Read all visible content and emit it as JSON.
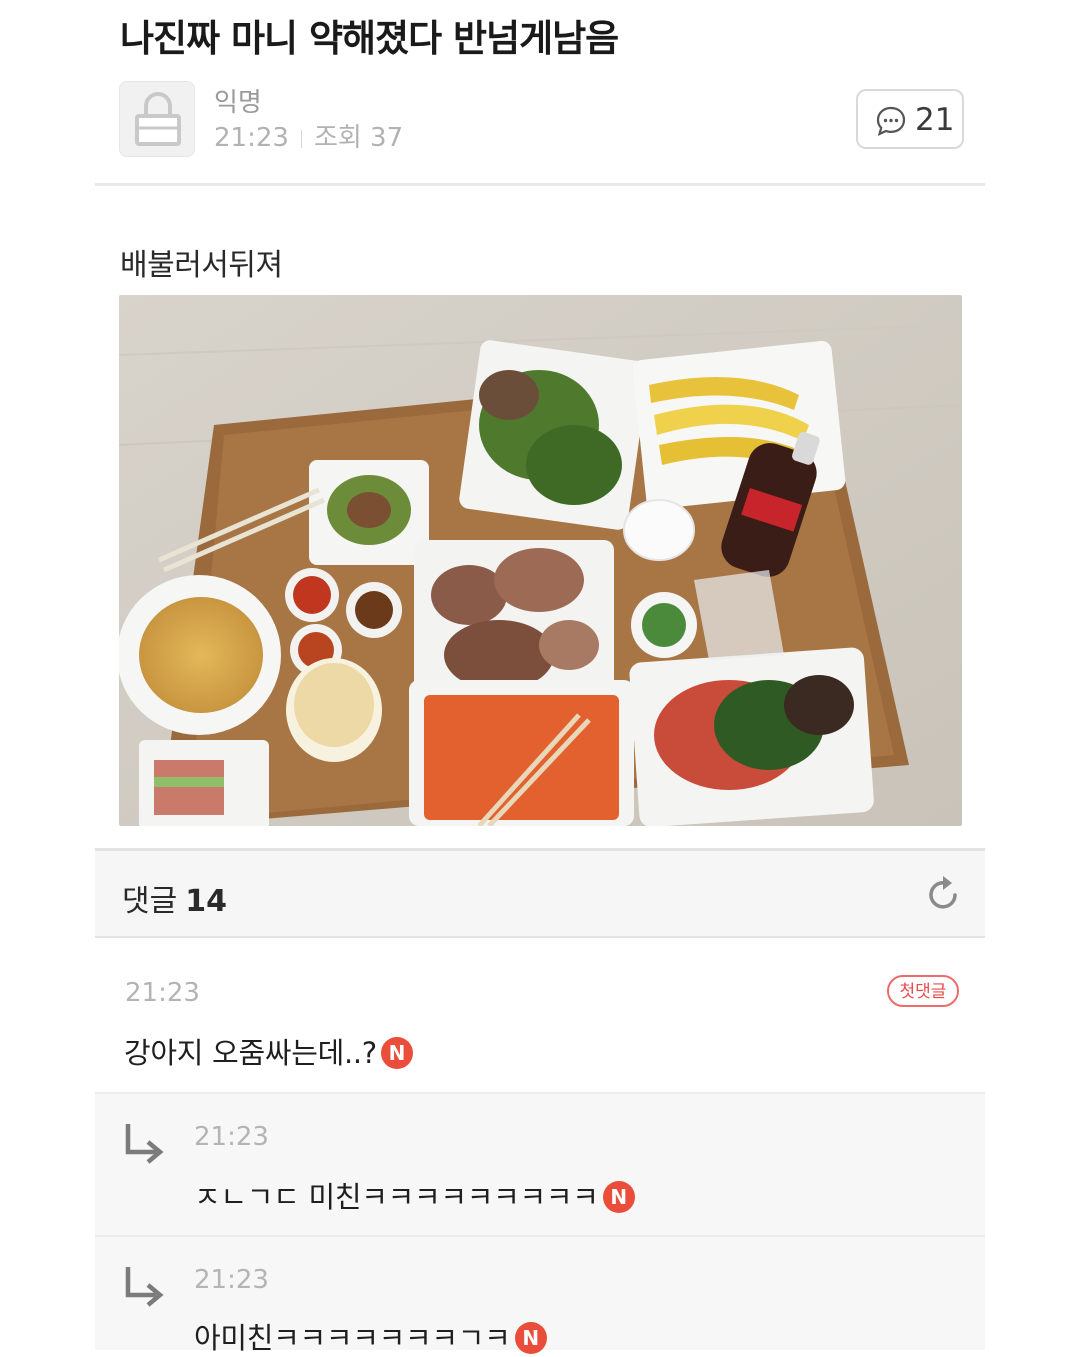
{
  "post": {
    "title": "나진짜 마니 약해졌다 반넘게남음",
    "author": "익명",
    "time": "21:23",
    "views_label": "조회 37",
    "comment_count": "21",
    "body": "배불러서뒤져",
    "photo_icon": "food-table-photo",
    "avatar_icon": "lock-icon"
  },
  "comments_header": {
    "label": "댓글",
    "count": "14",
    "refresh_icon": "refresh-icon"
  },
  "comments": [
    {
      "time": "21:23",
      "text": "강아지 오줌싸는데..?",
      "badge": "N",
      "first_label": "첫댓글"
    },
    {
      "time": "21:23",
      "text": "ㅈㄴㄱㄷ 미친ㅋㅋㅋㅋㅋㅋㅋㅋㅋ",
      "badge": "N"
    },
    {
      "time": "21:23",
      "text": "아미친ㅋㅋㅋㅋㅋㅋㅋㄱㅋ",
      "badge": "N"
    }
  ],
  "colors": {
    "new_badge": "#ea4d3a",
    "first_badge": "#ef6a6a",
    "muted_text": "#b4b4b4"
  }
}
